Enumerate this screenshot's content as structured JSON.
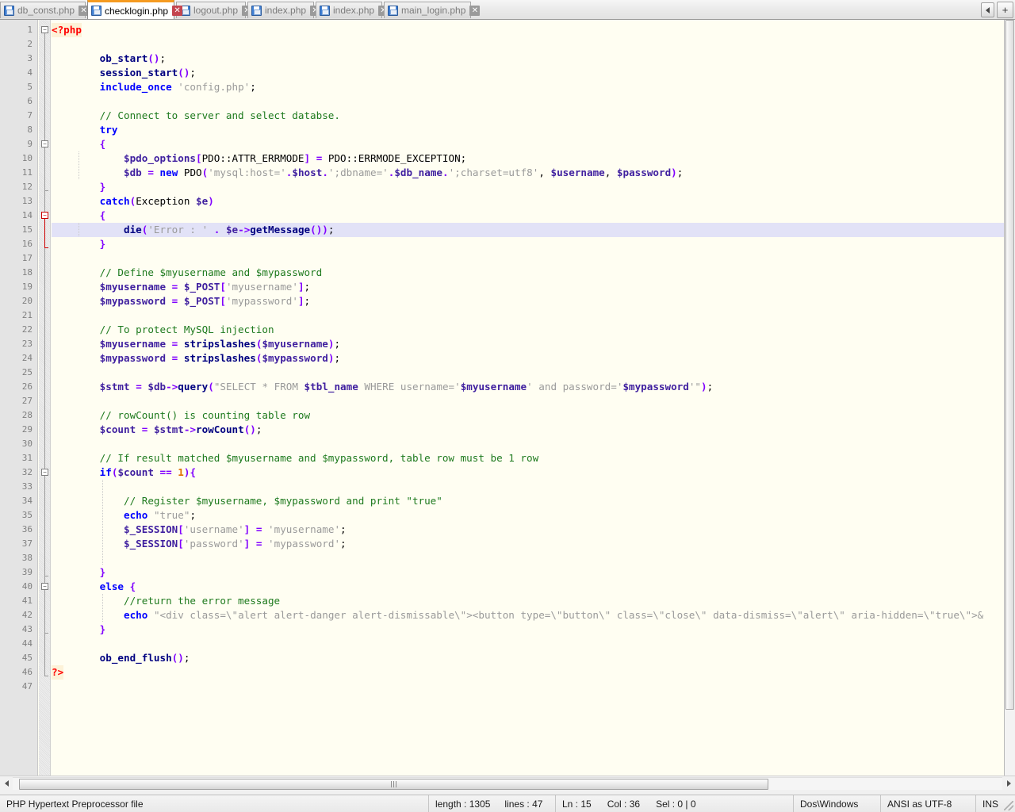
{
  "app": {
    "name": "Notepad++"
  },
  "tabs": {
    "items": [
      {
        "label": "db_const.php",
        "active": false
      },
      {
        "label": "checklogin.php",
        "active": true
      },
      {
        "label": "logout.php",
        "active": false
      },
      {
        "label": "index.php",
        "active": false
      },
      {
        "label": "index.php",
        "active": false
      },
      {
        "label": "main_login.php",
        "active": false
      }
    ],
    "nav_prev": "◀",
    "nav_add": "+"
  },
  "editor": {
    "total_lines": 47,
    "current_line": 15,
    "lines": [
      {
        "n": 1,
        "tokens": [
          {
            "c": "tag",
            "t": "<?php"
          }
        ]
      },
      {
        "n": 2,
        "tokens": []
      },
      {
        "n": 3,
        "tokens": [
          {
            "c": "plain",
            "t": "        "
          },
          {
            "c": "fn",
            "t": "ob_start"
          },
          {
            "c": "op",
            "t": "()"
          },
          {
            "c": "plain",
            "t": ";"
          }
        ]
      },
      {
        "n": 4,
        "tokens": [
          {
            "c": "plain",
            "t": "        "
          },
          {
            "c": "fn",
            "t": "session_start"
          },
          {
            "c": "op",
            "t": "()"
          },
          {
            "c": "plain",
            "t": ";"
          }
        ]
      },
      {
        "n": 5,
        "tokens": [
          {
            "c": "plain",
            "t": "        "
          },
          {
            "c": "kw",
            "t": "include_once"
          },
          {
            "c": "plain",
            "t": " "
          },
          {
            "c": "str",
            "t": "'config.php'"
          },
          {
            "c": "plain",
            "t": ";"
          }
        ]
      },
      {
        "n": 6,
        "tokens": []
      },
      {
        "n": 7,
        "tokens": [
          {
            "c": "plain",
            "t": "        "
          },
          {
            "c": "cmt",
            "t": "// Connect to server and select databse."
          }
        ]
      },
      {
        "n": 8,
        "tokens": [
          {
            "c": "plain",
            "t": "        "
          },
          {
            "c": "kw",
            "t": "try"
          }
        ]
      },
      {
        "n": 9,
        "tokens": [
          {
            "c": "plain",
            "t": "        "
          },
          {
            "c": "op",
            "t": "{"
          }
        ]
      },
      {
        "n": 10,
        "tokens": [
          {
            "c": "plain",
            "t": "            "
          },
          {
            "c": "var",
            "t": "$pdo_options"
          },
          {
            "c": "op",
            "t": "["
          },
          {
            "c": "plain",
            "t": "PDO::ATTR_ERRMODE"
          },
          {
            "c": "op",
            "t": "]"
          },
          {
            "c": "plain",
            "t": " "
          },
          {
            "c": "op",
            "t": "="
          },
          {
            "c": "plain",
            "t": " PDO::ERRMODE_EXCEPTION;"
          }
        ]
      },
      {
        "n": 11,
        "tokens": [
          {
            "c": "plain",
            "t": "            "
          },
          {
            "c": "var",
            "t": "$db"
          },
          {
            "c": "plain",
            "t": " "
          },
          {
            "c": "op",
            "t": "="
          },
          {
            "c": "plain",
            "t": " "
          },
          {
            "c": "kw",
            "t": "new"
          },
          {
            "c": "plain",
            "t": " PDO"
          },
          {
            "c": "op",
            "t": "("
          },
          {
            "c": "str",
            "t": "'mysql:host='"
          },
          {
            "c": "op",
            "t": "."
          },
          {
            "c": "var",
            "t": "$host"
          },
          {
            "c": "op",
            "t": "."
          },
          {
            "c": "str",
            "t": "';dbname='"
          },
          {
            "c": "op",
            "t": "."
          },
          {
            "c": "var",
            "t": "$db_name"
          },
          {
            "c": "op",
            "t": "."
          },
          {
            "c": "str",
            "t": "';charset=utf8'"
          },
          {
            "c": "plain",
            "t": ", "
          },
          {
            "c": "var",
            "t": "$username"
          },
          {
            "c": "plain",
            "t": ", "
          },
          {
            "c": "var",
            "t": "$password"
          },
          {
            "c": "op",
            "t": ")"
          },
          {
            "c": "plain",
            "t": ";"
          }
        ]
      },
      {
        "n": 12,
        "tokens": [
          {
            "c": "plain",
            "t": "        "
          },
          {
            "c": "op",
            "t": "}"
          }
        ]
      },
      {
        "n": 13,
        "tokens": [
          {
            "c": "plain",
            "t": "        "
          },
          {
            "c": "kw",
            "t": "catch"
          },
          {
            "c": "op",
            "t": "("
          },
          {
            "c": "plain",
            "t": "Exception "
          },
          {
            "c": "var",
            "t": "$e"
          },
          {
            "c": "op",
            "t": ")"
          }
        ]
      },
      {
        "n": 14,
        "tokens": [
          {
            "c": "plain",
            "t": "        "
          },
          {
            "c": "op",
            "t": "{"
          }
        ]
      },
      {
        "n": 15,
        "tokens": [
          {
            "c": "plain",
            "t": "            "
          },
          {
            "c": "fn",
            "t": "die"
          },
          {
            "c": "op",
            "t": "("
          },
          {
            "c": "str",
            "t": "'Error : '"
          },
          {
            "c": "plain",
            "t": " "
          },
          {
            "c": "op",
            "t": "."
          },
          {
            "c": "plain",
            "t": " "
          },
          {
            "c": "var",
            "t": "$e"
          },
          {
            "c": "op",
            "t": "->"
          },
          {
            "c": "fn",
            "t": "getMessage"
          },
          {
            "c": "op",
            "t": "()"
          },
          {
            "c": "op",
            "t": ")"
          },
          {
            "c": "plain",
            "t": ";"
          }
        ]
      },
      {
        "n": 16,
        "tokens": [
          {
            "c": "plain",
            "t": "        "
          },
          {
            "c": "op",
            "t": "}"
          }
        ]
      },
      {
        "n": 17,
        "tokens": []
      },
      {
        "n": 18,
        "tokens": [
          {
            "c": "plain",
            "t": "        "
          },
          {
            "c": "cmt",
            "t": "// Define $myusername and $mypassword"
          }
        ]
      },
      {
        "n": 19,
        "tokens": [
          {
            "c": "plain",
            "t": "        "
          },
          {
            "c": "var",
            "t": "$myusername"
          },
          {
            "c": "plain",
            "t": " "
          },
          {
            "c": "op",
            "t": "="
          },
          {
            "c": "plain",
            "t": " "
          },
          {
            "c": "var",
            "t": "$_POST"
          },
          {
            "c": "op",
            "t": "["
          },
          {
            "c": "str",
            "t": "'myusername'"
          },
          {
            "c": "op",
            "t": "]"
          },
          {
            "c": "plain",
            "t": ";"
          }
        ]
      },
      {
        "n": 20,
        "tokens": [
          {
            "c": "plain",
            "t": "        "
          },
          {
            "c": "var",
            "t": "$mypassword"
          },
          {
            "c": "plain",
            "t": " "
          },
          {
            "c": "op",
            "t": "="
          },
          {
            "c": "plain",
            "t": " "
          },
          {
            "c": "var",
            "t": "$_POST"
          },
          {
            "c": "op",
            "t": "["
          },
          {
            "c": "str",
            "t": "'mypassword'"
          },
          {
            "c": "op",
            "t": "]"
          },
          {
            "c": "plain",
            "t": ";"
          }
        ]
      },
      {
        "n": 21,
        "tokens": []
      },
      {
        "n": 22,
        "tokens": [
          {
            "c": "plain",
            "t": "        "
          },
          {
            "c": "cmt",
            "t": "// To protect MySQL injection"
          }
        ]
      },
      {
        "n": 23,
        "tokens": [
          {
            "c": "plain",
            "t": "        "
          },
          {
            "c": "var",
            "t": "$myusername"
          },
          {
            "c": "plain",
            "t": " "
          },
          {
            "c": "op",
            "t": "="
          },
          {
            "c": "plain",
            "t": " "
          },
          {
            "c": "fn",
            "t": "stripslashes"
          },
          {
            "c": "op",
            "t": "("
          },
          {
            "c": "var",
            "t": "$myusername"
          },
          {
            "c": "op",
            "t": ")"
          },
          {
            "c": "plain",
            "t": ";"
          }
        ]
      },
      {
        "n": 24,
        "tokens": [
          {
            "c": "plain",
            "t": "        "
          },
          {
            "c": "var",
            "t": "$mypassword"
          },
          {
            "c": "plain",
            "t": " "
          },
          {
            "c": "op",
            "t": "="
          },
          {
            "c": "plain",
            "t": " "
          },
          {
            "c": "fn",
            "t": "stripslashes"
          },
          {
            "c": "op",
            "t": "("
          },
          {
            "c": "var",
            "t": "$mypassword"
          },
          {
            "c": "op",
            "t": ")"
          },
          {
            "c": "plain",
            "t": ";"
          }
        ]
      },
      {
        "n": 25,
        "tokens": []
      },
      {
        "n": 26,
        "tokens": [
          {
            "c": "plain",
            "t": "        "
          },
          {
            "c": "var",
            "t": "$stmt"
          },
          {
            "c": "plain",
            "t": " "
          },
          {
            "c": "op",
            "t": "="
          },
          {
            "c": "plain",
            "t": " "
          },
          {
            "c": "var",
            "t": "$db"
          },
          {
            "c": "op",
            "t": "->"
          },
          {
            "c": "fn",
            "t": "query"
          },
          {
            "c": "op",
            "t": "("
          },
          {
            "c": "str",
            "t": "\"SELECT * FROM "
          },
          {
            "c": "var",
            "t": "$tbl_name"
          },
          {
            "c": "str",
            "t": " WHERE username='"
          },
          {
            "c": "var",
            "t": "$myusername"
          },
          {
            "c": "str",
            "t": "' and password='"
          },
          {
            "c": "var",
            "t": "$mypassword"
          },
          {
            "c": "str",
            "t": "'\""
          },
          {
            "c": "op",
            "t": ")"
          },
          {
            "c": "plain",
            "t": ";"
          }
        ]
      },
      {
        "n": 27,
        "tokens": []
      },
      {
        "n": 28,
        "tokens": [
          {
            "c": "plain",
            "t": "        "
          },
          {
            "c": "cmt",
            "t": "// rowCount() is counting table row"
          }
        ]
      },
      {
        "n": 29,
        "tokens": [
          {
            "c": "plain",
            "t": "        "
          },
          {
            "c": "var",
            "t": "$count"
          },
          {
            "c": "plain",
            "t": " "
          },
          {
            "c": "op",
            "t": "="
          },
          {
            "c": "plain",
            "t": " "
          },
          {
            "c": "var",
            "t": "$stmt"
          },
          {
            "c": "op",
            "t": "->"
          },
          {
            "c": "fn",
            "t": "rowCount"
          },
          {
            "c": "op",
            "t": "()"
          },
          {
            "c": "plain",
            "t": ";"
          }
        ]
      },
      {
        "n": 30,
        "tokens": []
      },
      {
        "n": 31,
        "tokens": [
          {
            "c": "plain",
            "t": "        "
          },
          {
            "c": "cmt",
            "t": "// If result matched $myusername and $mypassword, table row must be 1 row"
          }
        ]
      },
      {
        "n": 32,
        "tokens": [
          {
            "c": "plain",
            "t": "        "
          },
          {
            "c": "kw",
            "t": "if"
          },
          {
            "c": "op",
            "t": "("
          },
          {
            "c": "var",
            "t": "$count"
          },
          {
            "c": "plain",
            "t": " "
          },
          {
            "c": "op",
            "t": "=="
          },
          {
            "c": "plain",
            "t": " "
          },
          {
            "c": "num",
            "t": "1"
          },
          {
            "c": "op",
            "t": ")"
          },
          {
            "c": "op",
            "t": "{"
          }
        ]
      },
      {
        "n": 33,
        "tokens": []
      },
      {
        "n": 34,
        "tokens": [
          {
            "c": "plain",
            "t": "            "
          },
          {
            "c": "cmt",
            "t": "// Register $myusername, $mypassword and print \"true\""
          }
        ]
      },
      {
        "n": 35,
        "tokens": [
          {
            "c": "plain",
            "t": "            "
          },
          {
            "c": "kw",
            "t": "echo"
          },
          {
            "c": "plain",
            "t": " "
          },
          {
            "c": "str",
            "t": "\"true\""
          },
          {
            "c": "plain",
            "t": ";"
          }
        ]
      },
      {
        "n": 36,
        "tokens": [
          {
            "c": "plain",
            "t": "            "
          },
          {
            "c": "var",
            "t": "$_SESSION"
          },
          {
            "c": "op",
            "t": "["
          },
          {
            "c": "str",
            "t": "'username'"
          },
          {
            "c": "op",
            "t": "]"
          },
          {
            "c": "plain",
            "t": " "
          },
          {
            "c": "op",
            "t": "="
          },
          {
            "c": "plain",
            "t": " "
          },
          {
            "c": "str",
            "t": "'myusername'"
          },
          {
            "c": "plain",
            "t": ";"
          }
        ]
      },
      {
        "n": 37,
        "tokens": [
          {
            "c": "plain",
            "t": "            "
          },
          {
            "c": "var",
            "t": "$_SESSION"
          },
          {
            "c": "op",
            "t": "["
          },
          {
            "c": "str",
            "t": "'password'"
          },
          {
            "c": "op",
            "t": "]"
          },
          {
            "c": "plain",
            "t": " "
          },
          {
            "c": "op",
            "t": "="
          },
          {
            "c": "plain",
            "t": " "
          },
          {
            "c": "str",
            "t": "'mypassword'"
          },
          {
            "c": "plain",
            "t": ";"
          }
        ]
      },
      {
        "n": 38,
        "tokens": []
      },
      {
        "n": 39,
        "tokens": [
          {
            "c": "plain",
            "t": "        "
          },
          {
            "c": "op",
            "t": "}"
          }
        ]
      },
      {
        "n": 40,
        "tokens": [
          {
            "c": "plain",
            "t": "        "
          },
          {
            "c": "kw",
            "t": "else"
          },
          {
            "c": "plain",
            "t": " "
          },
          {
            "c": "op",
            "t": "{"
          }
        ]
      },
      {
        "n": 41,
        "tokens": [
          {
            "c": "plain",
            "t": "            "
          },
          {
            "c": "cmt",
            "t": "//return the error message"
          }
        ]
      },
      {
        "n": 42,
        "tokens": [
          {
            "c": "plain",
            "t": "            "
          },
          {
            "c": "kw",
            "t": "echo"
          },
          {
            "c": "plain",
            "t": " "
          },
          {
            "c": "str",
            "t": "\"<div class=\\\"alert alert-danger alert-dismissable\\\"><button type=\\\"button\\\" class=\\\"close\\\" data-dismiss=\\\"alert\\\" aria-hidden=\\\"true\\\">&"
          }
        ]
      },
      {
        "n": 43,
        "tokens": [
          {
            "c": "plain",
            "t": "        "
          },
          {
            "c": "op",
            "t": "}"
          }
        ]
      },
      {
        "n": 44,
        "tokens": []
      },
      {
        "n": 45,
        "tokens": [
          {
            "c": "plain",
            "t": "        "
          },
          {
            "c": "fn",
            "t": "ob_end_flush"
          },
          {
            "c": "op",
            "t": "()"
          },
          {
            "c": "plain",
            "t": ";"
          }
        ]
      },
      {
        "n": 46,
        "tokens": [
          {
            "c": "tag",
            "t": "?>"
          }
        ]
      },
      {
        "n": 47,
        "tokens": []
      }
    ]
  },
  "statusbar": {
    "file_type": "PHP Hypertext Preprocessor file",
    "length_label": "length : 1305",
    "lines_label": "lines : 47",
    "ln_label": "Ln : 15",
    "col_label": "Col : 36",
    "sel_label": "Sel : 0 | 0",
    "eol": "Dos\\Windows",
    "encoding": "ANSI as UTF-8",
    "insert_mode": "INS"
  }
}
